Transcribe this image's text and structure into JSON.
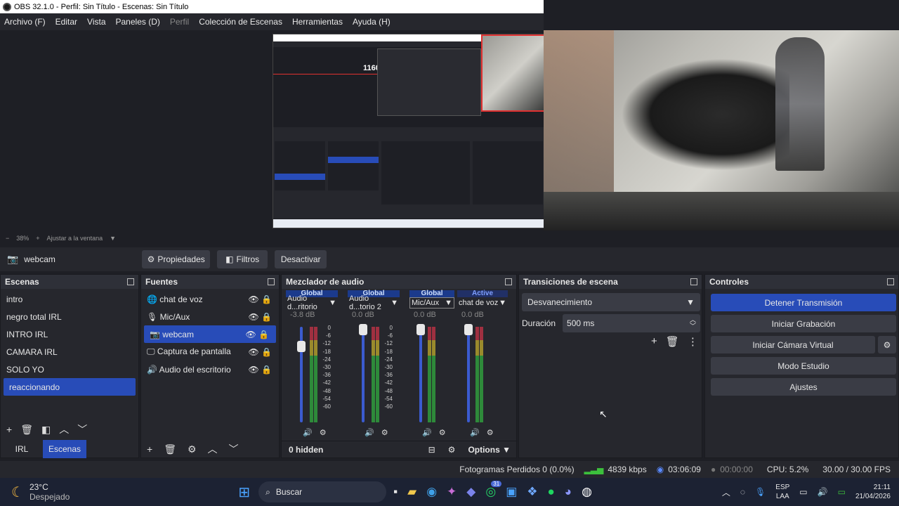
{
  "window": {
    "title": "OBS 32.1.0 - Perfil: Sin Título - Escenas: Sin Título"
  },
  "menu": [
    "Archivo (F)",
    "Editar",
    "Vista",
    "Paneles (D)",
    "Perfil",
    "Colección de Escenas",
    "Herramientas",
    "Ayuda (H)"
  ],
  "preview": {
    "nested_label": "1160 px",
    "zoom": "38%",
    "fit_label": "Ajustar a la ventana"
  },
  "source_toolbar": {
    "source_name": "webcam",
    "properties": "Propiedades",
    "filters": "Filtros",
    "deactivate": "Desactivar"
  },
  "scenes": {
    "title": "Escenas",
    "items": [
      "intro",
      "negro total IRL",
      "INTRO IRL",
      "CAMARA IRL",
      "SOLO YO",
      "reaccionando"
    ],
    "selected": "reaccionando",
    "tabs": [
      "IRL",
      "Escenas"
    ]
  },
  "sources": {
    "title": "Fuentes",
    "items": [
      "chat de voz",
      "Mic/Aux",
      "webcam",
      "Captura de pantalla",
      "Audio del escritorio"
    ],
    "selected": "webcam"
  },
  "mixer": {
    "title": "Mezclador de audio",
    "channels": [
      {
        "head": "Global",
        "name": "Audio d...ritorio",
        "db": "-3.8 dB",
        "level": 0.18
      },
      {
        "head": "Global",
        "name": "Audio d...torio 2",
        "db": "0.0 dB",
        "level": 0.0
      },
      {
        "head": "Global",
        "name": "Mic/Aux",
        "db": "0.0 dB",
        "level": 0.0
      },
      {
        "head": "Active",
        "name": "chat de voz",
        "db": "0.0 dB",
        "level": 0.0
      }
    ],
    "scale": [
      "0",
      "-6",
      "-12",
      "-18",
      "-24",
      "-30",
      "-36",
      "-42",
      "-48",
      "-54",
      "-60"
    ],
    "hidden": "0 hidden",
    "options": "Options"
  },
  "transitions": {
    "title": "Transiciones de escena",
    "selected": "Desvanecimiento",
    "duration_label": "Duración",
    "duration_value": "500 ms"
  },
  "controls": {
    "title": "Controles",
    "stop_stream": "Detener Transmisión",
    "start_recording": "Iniciar Grabación",
    "virtual_cam": "Iniciar Cámara Virtual",
    "studio_mode": "Modo Estudio",
    "settings": "Ajustes"
  },
  "status": {
    "dropped": "Fotogramas Perdidos 0 (0.0%)",
    "bitrate": "4839 kbps",
    "stream_time": "03:06:09",
    "rec_time": "00:00:00",
    "cpu": "CPU: 5.2%",
    "fps": "30.00 / 30.00 FPS"
  },
  "taskbar": {
    "temp": "23°C",
    "weather": "Despejado",
    "search": "Buscar",
    "lang1": "ESP",
    "lang2": "LAA",
    "time": "21:11",
    "date": "21/04/2026",
    "badge": "31"
  },
  "colors": {
    "accent": "#284cb8",
    "panel": "#26272d",
    "background": "#1e1f25"
  }
}
